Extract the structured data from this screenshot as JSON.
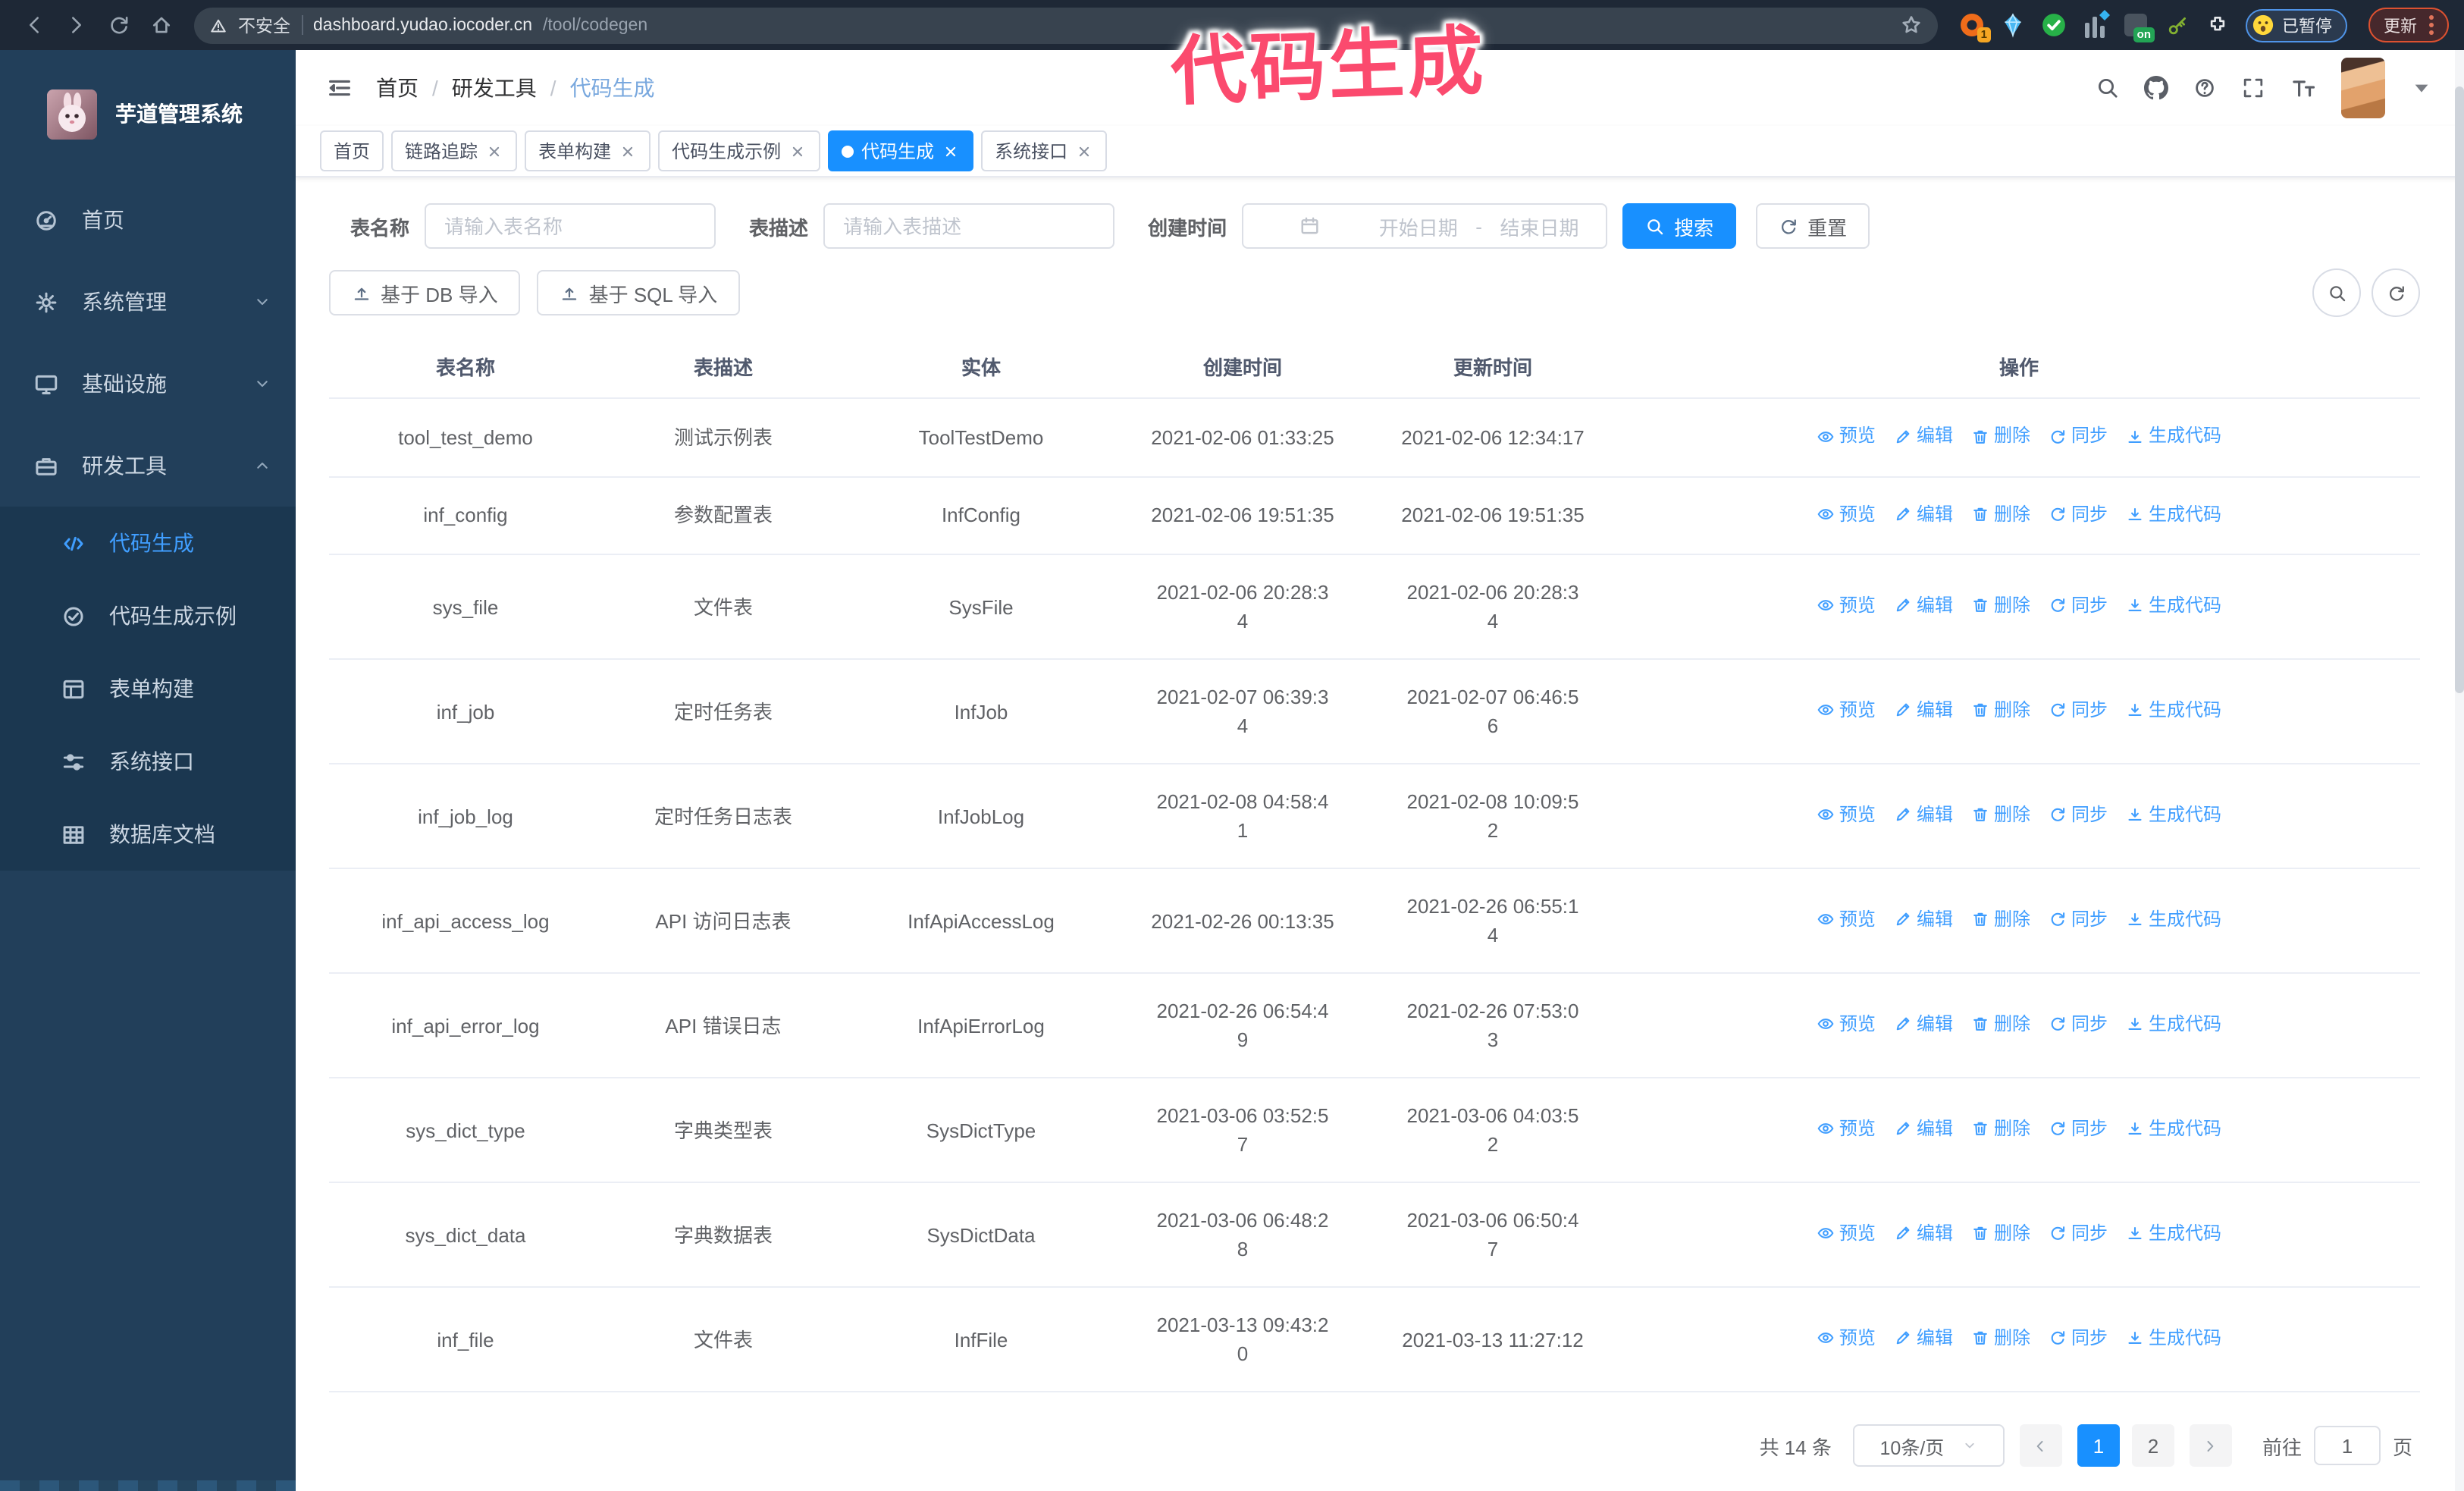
{
  "colors": {
    "accent": "#1890ff",
    "link": "#409eff",
    "sidebar_bg": "#223f5a",
    "submenu_bg": "#1b3750",
    "annotation": "#fb4a6e"
  },
  "browser": {
    "security_label": "不安全",
    "url_host": "dashboard.yudao.iocoder.cn",
    "url_path": "/tool/codegen",
    "extension_badge": "1",
    "extension_on_badge": "on",
    "paused_badge": "已暂停",
    "update_button": "更新"
  },
  "annotation": {
    "text": "代码生成"
  },
  "sidebar": {
    "title": "芋道管理系统",
    "items": [
      {
        "label": "首页",
        "icon": "dashboard-icon"
      },
      {
        "label": "系统管理",
        "icon": "gear-icon",
        "chevron": "down"
      },
      {
        "label": "基础设施",
        "icon": "monitor-icon",
        "chevron": "down"
      },
      {
        "label": "研发工具",
        "icon": "toolbox-icon",
        "chevron": "up",
        "children": [
          {
            "label": "代码生成",
            "icon": "code-icon",
            "active": true
          },
          {
            "label": "代码生成示例",
            "icon": "check-circle-icon"
          },
          {
            "label": "表单构建",
            "icon": "form-icon"
          },
          {
            "label": "系统接口",
            "icon": "sliders-icon"
          },
          {
            "label": "数据库文档",
            "icon": "database-icon"
          }
        ]
      }
    ]
  },
  "header": {
    "breadcrumb": [
      "首页",
      "研发工具",
      "代码生成"
    ],
    "separator": "/"
  },
  "tags": [
    {
      "label": "首页"
    },
    {
      "label": "链路追踪",
      "closable": true
    },
    {
      "label": "表单构建",
      "closable": true
    },
    {
      "label": "代码生成示例",
      "closable": true
    },
    {
      "label": "代码生成",
      "closable": true,
      "active": true
    },
    {
      "label": "系统接口",
      "closable": true
    }
  ],
  "filters": {
    "table_name_label": "表名称",
    "table_name_placeholder": "请输入表名称",
    "table_desc_label": "表描述",
    "table_desc_placeholder": "请输入表描述",
    "create_time_label": "创建时间",
    "date_start_placeholder": "开始日期",
    "date_separator": "-",
    "date_end_placeholder": "结束日期",
    "search_label": "搜索",
    "reset_label": "重置"
  },
  "toolbar": {
    "import_db_label": "基于 DB 导入",
    "import_sql_label": "基于 SQL 导入"
  },
  "table": {
    "columns": [
      "表名称",
      "表描述",
      "实体",
      "创建时间",
      "更新时间",
      "操作"
    ],
    "actions": [
      "预览",
      "编辑",
      "删除",
      "同步",
      "生成代码"
    ],
    "rows": [
      {
        "name": "tool_test_demo",
        "desc": "测试示例表",
        "entity": "ToolTestDemo",
        "created": "2021-02-06 01:33:25",
        "updated": "2021-02-06 12:34:17"
      },
      {
        "name": "inf_config",
        "desc": "参数配置表",
        "entity": "InfConfig",
        "created": "2021-02-06 19:51:35",
        "updated": "2021-02-06 19:51:35"
      },
      {
        "name": "sys_file",
        "desc": "文件表",
        "entity": "SysFile",
        "created": "2021-02-06 20:28:3\n4",
        "updated": "2021-02-06 20:28:3\n4"
      },
      {
        "name": "inf_job",
        "desc": "定时任务表",
        "entity": "InfJob",
        "created": "2021-02-07 06:39:3\n4",
        "updated": "2021-02-07 06:46:5\n6"
      },
      {
        "name": "inf_job_log",
        "desc": "定时任务日志表",
        "entity": "InfJobLog",
        "created": "2021-02-08 04:58:4\n1",
        "updated": "2021-02-08 10:09:5\n2"
      },
      {
        "name": "inf_api_access_log",
        "desc": "API 访问日志表",
        "entity": "InfApiAccessLog",
        "created": "2021-02-26 00:13:35",
        "updated": "2021-02-26 06:55:1\n4"
      },
      {
        "name": "inf_api_error_log",
        "desc": "API 错误日志",
        "entity": "InfApiErrorLog",
        "created": "2021-02-26 06:54:4\n9",
        "updated": "2021-02-26 07:53:0\n3"
      },
      {
        "name": "sys_dict_type",
        "desc": "字典类型表",
        "entity": "SysDictType",
        "created": "2021-03-06 03:52:5\n7",
        "updated": "2021-03-06 04:03:5\n2"
      },
      {
        "name": "sys_dict_data",
        "desc": "字典数据表",
        "entity": "SysDictData",
        "created": "2021-03-06 06:48:2\n8",
        "updated": "2021-03-06 06:50:4\n7"
      },
      {
        "name": "inf_file",
        "desc": "文件表",
        "entity": "InfFile",
        "created": "2021-03-13 09:43:2\n0",
        "updated": "2021-03-13 11:27:12"
      }
    ]
  },
  "pagination": {
    "total": "共 14 条",
    "page_size": "10条/页",
    "pages": [
      "1",
      "2"
    ],
    "active_page": "1",
    "goto_label": "前往",
    "goto_value": "1",
    "page_label": "页"
  }
}
